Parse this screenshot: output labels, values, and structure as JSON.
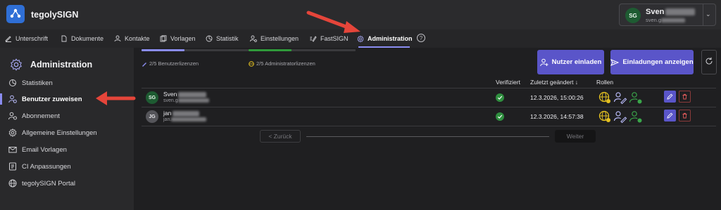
{
  "app": {
    "name": "tegolySIGN"
  },
  "user": {
    "initials": "SG",
    "name": "Sven",
    "email": "sven.g"
  },
  "nav": [
    {
      "label": "Unterschrift",
      "icon": "signature-icon"
    },
    {
      "label": "Dokumente",
      "icon": "document-icon"
    },
    {
      "label": "Kontakte",
      "icon": "contacts-icon"
    },
    {
      "label": "Vorlagen",
      "icon": "templates-icon"
    },
    {
      "label": "Statistik",
      "icon": "statistics-icon"
    },
    {
      "label": "Einstellungen",
      "icon": "user-settings-icon"
    },
    {
      "label": "FastSIGN",
      "icon": "fastsign-icon"
    },
    {
      "label": "Administration",
      "icon": "gear-icon",
      "active": true
    }
  ],
  "sidebar": {
    "title": "Administration",
    "items": [
      {
        "label": "Statistiken",
        "icon": "statistics-icon"
      },
      {
        "label": "Benutzer zuweisen",
        "icon": "assign-user-icon",
        "active": true
      },
      {
        "label": "Abonnement",
        "icon": "subscription-icon"
      },
      {
        "label": "Allgemeine Einstellungen",
        "icon": "settings-icon"
      },
      {
        "label": "Email Vorlagen",
        "icon": "email-icon"
      },
      {
        "label": "CI Anpassungen",
        "icon": "ci-icon"
      },
      {
        "label": "tegolySIGN Portal",
        "icon": "globe-icon"
      }
    ]
  },
  "licenses": {
    "user": {
      "label": "2/5 Benutzerlizenzen",
      "used": 2,
      "total": 5,
      "color": "#8a8cf0"
    },
    "admin": {
      "label": "2/5 Administratorlizenzen",
      "used": 2,
      "total": 5,
      "color": "#2f9a3a"
    }
  },
  "buttons": {
    "invite": "Nutzer einladen",
    "show_invites": "Einladungen anzeigen"
  },
  "table": {
    "headers": {
      "verified": "Verifiziert",
      "changed": "Zuletzt geändert ↓",
      "roles": "Rollen"
    },
    "rows": [
      {
        "initials": "SG",
        "name": "Sven",
        "email": "sven.g",
        "date": "12.3.2026, 15:00:26",
        "avatar_bg": "#1e5b32",
        "avatar_fg": "#e9f4ec"
      },
      {
        "initials": "JG",
        "name": "jan",
        "email": "jan.",
        "date": "12.3.2026, 14:57:38",
        "avatar_bg": "#55555a",
        "avatar_fg": "#e6e6ea"
      }
    ]
  },
  "pager": {
    "prev": "< Zurück",
    "next": "Weiter"
  },
  "colors": {
    "accent": "#5a55c9",
    "annotation_arrow": "#e5453a",
    "verified": "#2f8f3f",
    "role_yellow": "#e3c021",
    "role_green": "#3aa64a"
  }
}
